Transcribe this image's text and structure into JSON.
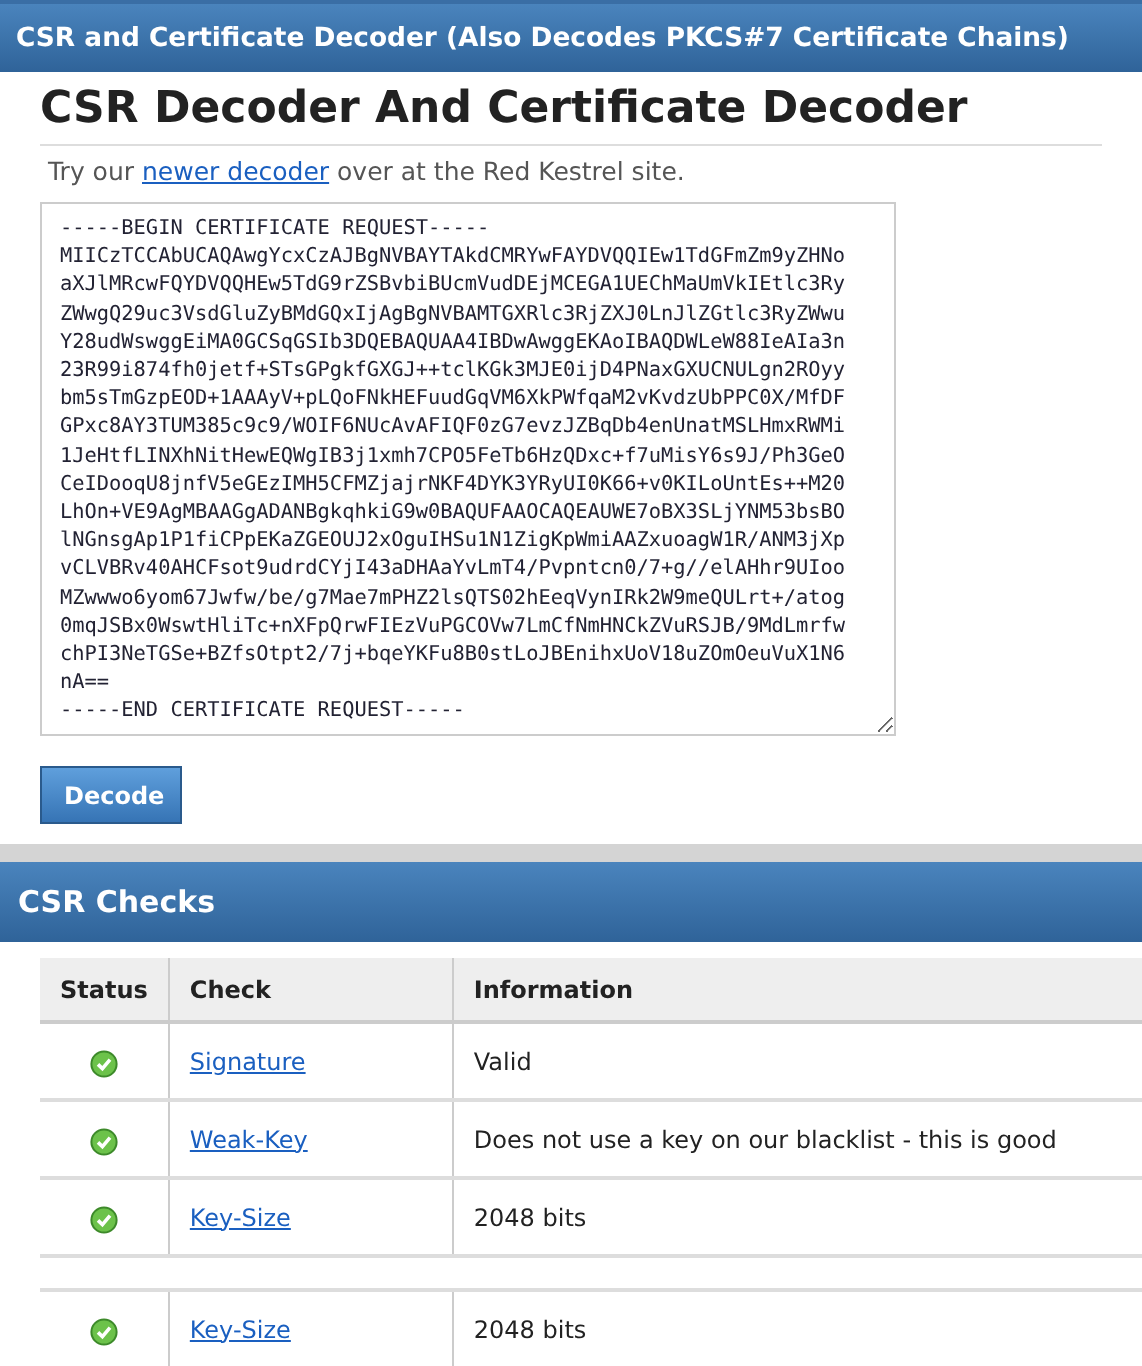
{
  "header": {
    "title": "CSR and Certificate Decoder (Also Decodes PKCS#7 Certificate Chains)"
  },
  "page_title": "CSR Decoder And Certificate Decoder",
  "intro": {
    "before": "Try our ",
    "link": "newer decoder",
    "after": " over at the Red Kestrel site."
  },
  "input": {
    "value": "-----BEGIN CERTIFICATE REQUEST-----\nMIICzTCCAbUCAQAwgYcxCzAJBgNVBAYTAkdCMRYwFAYDVQQIEw1TdGFmZm9yZHNo\naXJlMRcwFQYDVQQHEw5TdG9rZSBvbiBUcmVudDEjMCEGA1UEChMaUmVkIEtlc3Ry\nZWwgQ29uc3VsdGluZyBMdGQxIjAgBgNVBAMTGXRlc3RjZXJ0LnJlZGtlc3RyZWwu\nY28udWswggEiMA0GCSqGSIb3DQEBAQUAA4IBDwAwggEKAoIBAQDWLeW88IeAIa3n\n23R99i874fh0jetf+STsGPgkfGXGJ++tclKGk3MJE0ijD4PNaxGXUCNULgn2ROyy\nbm5sTmGzpEOD+1AAAyV+pLQoFNkHEFuudGqVM6XkPWfqaM2vKvdzUbPPC0X/MfDF\nGPxc8AY3TUM385c9c9/WOIF6NUcAvAFIQF0zG7evzJZBqDb4enUnatMSLHmxRWMi\n1JeHtfLINXhNitHewEQWgIB3j1xmh7CPO5FeTb6HzQDxc+f7uMisY6s9J/Ph3GeO\nCeIDooqU8jnfV5eGEzIMH5CFMZjajrNKF4DYK3YRyUI0K66+v0KILoUntEs++M20\nLhOn+VE9AgMBAAGgADANBgkqhkiG9w0BAQUFAAOCAQEAUWE7oBX3SLjYNM53bsBO\nlNGnsgAp1P1fiCPpEKaZGEOUJ2xOguIHSu1N1ZigKpWmiAAZxuoagW1R/ANM3jXp\nvCLVBRv40AHCFsot9udrdCYjI43aDHAaYvLmT4/Pvpntcn0/7+g//elAHhr9UIoo\nMZwwwo6yom67Jwfw/be/g7Mae7mPHZ2lsQTS02hEeqVynIRk2W9meQULrt+/atog\n0mqJSBx0WswtHliTc+nXFpQrwFIEzVuPGCOVw7LmCfNmHNCkZVuRSJB/9MdLmrfw\nchPI3NeTGSe+BZfsOtpt2/7j+bqeYKFu8B0stLoJBEnihxUoV18uZOmOeuVuX1N6\nnA==\n-----END CERTIFICATE REQUEST-----"
  },
  "decode_button": "Decode",
  "checks": {
    "title": "CSR Checks",
    "columns": [
      "Status",
      "Check",
      "Information"
    ],
    "row_groups": [
      [
        {
          "passed": true,
          "check": "Signature",
          "information": "Valid"
        },
        {
          "passed": true,
          "check": "Weak-Key",
          "information": "Does not use a key on our blacklist - this is good"
        },
        {
          "passed": true,
          "check": "Key-Size",
          "information": "2048 bits"
        }
      ],
      [
        {
          "passed": true,
          "check": "Key-Size",
          "information": "2048 bits"
        }
      ]
    ]
  }
}
